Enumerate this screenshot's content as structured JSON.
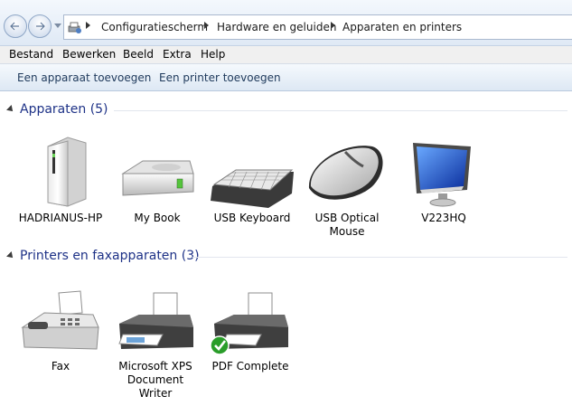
{
  "breadcrumb": [
    "Configuratiescherm",
    "Hardware en geluiden",
    "Apparaten en printers"
  ],
  "menu": [
    "Bestand",
    "Bewerken",
    "Beeld",
    "Extra",
    "Help"
  ],
  "commands": [
    "Een apparaat toevoegen",
    "Een printer toevoegen"
  ],
  "groups": {
    "devices": {
      "title": "Apparaten (5)",
      "items": [
        "HADRIANUS-HP",
        "My Book",
        "USB Keyboard",
        "USB Optical Mouse",
        "V223HQ"
      ]
    },
    "printers": {
      "title": "Printers en faxapparaten (3)",
      "items": [
        "Fax",
        "Microsoft XPS Document Writer",
        "PDF Complete"
      ]
    }
  },
  "colors": {
    "group_title": "#1e3287",
    "default_check": "#2a9d2a"
  }
}
